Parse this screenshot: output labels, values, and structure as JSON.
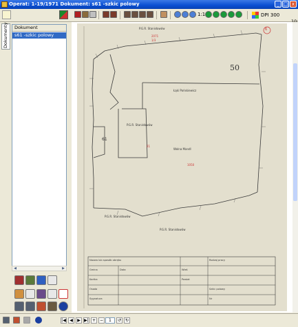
{
  "window": {
    "title": "Operat: 1-19/1971   Dokument: s61 -szkic polowy",
    "buttons": {
      "minimize": "_",
      "maximize": "□",
      "close": "x"
    }
  },
  "toolbar": {
    "zoom_label": "1:1",
    "dpi_label": "DPI 300",
    "right_clip": "10:5"
  },
  "side": {
    "tab_label": "Dokumenty",
    "column_header": "Dokument",
    "items": [
      "s61 -szkic polowy"
    ]
  },
  "document": {
    "stamp_top": "6",
    "parcel_number": "50",
    "labels": {
      "top_owner": "P.G.R. Stanisławów",
      "center_owner": "Łąki Pańskiewicz",
      "left_parcel": "P.G.R. Stanisławów",
      "left_parcel_id": "61",
      "bottom_left": "P.G.R. Stanisławów",
      "bottom_right": "P.G.R. Stanisławów",
      "note": "Wolna Mandl",
      "red_a": "2071",
      "red_b": "1/3",
      "red_c": "1050",
      "red_d": "21"
    },
    "form": {
      "row1_left": "Nazwa lub sposób obrębu",
      "row1_right": "Rodzaj pracy",
      "gmina": "Gmina",
      "powiat": "Powiat",
      "wies": "Wieś",
      "kartka": "Kartka",
      "osada": "Osada",
      "szkic_polowy": "Szkic polowy",
      "no_label": "Nr",
      "sygnatura": "Sygnatura",
      "date_label": "Data"
    }
  },
  "statusbar": {
    "page_value": "1"
  }
}
